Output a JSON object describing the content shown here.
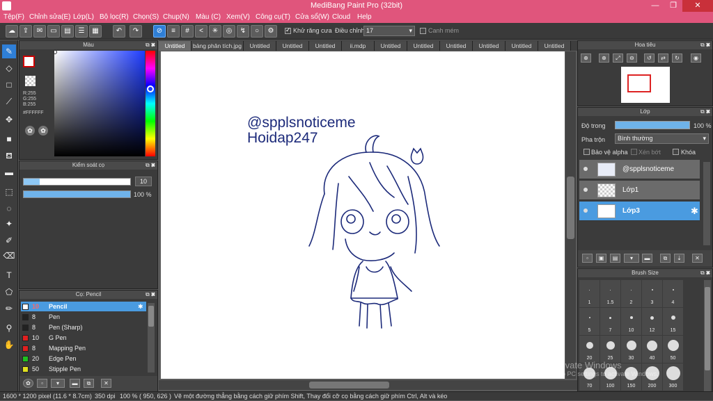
{
  "window": {
    "title": "MediBang Paint Pro (32bit)",
    "minimize": "—",
    "maximize": "❐",
    "close": "✕"
  },
  "menu": [
    "Tệp(F)",
    "Chỉnh sửa(E)",
    "Lớp(L)",
    "Bộ lọc(R)",
    "Chọn(S)",
    "Chup(N)",
    "Màu (C)",
    "Xem(V)",
    "Công cụ(T)",
    "Cửa sổ(W)",
    "Cloud",
    "Help"
  ],
  "toolbar": {
    "antialias_label": "Khử răng cưa",
    "adjust_label": "Điều chỉnh",
    "adjust_value": "17",
    "snap_label": "Canh mém"
  },
  "color_panel": {
    "title": "Màu",
    "r": "R:255",
    "g": "G:255",
    "b": "B:255",
    "hex": "#FFFFFF"
  },
  "brush_control": {
    "title": "Kiểm soát cọ",
    "size": "10",
    "opacity": "100 %",
    "size_fraction": 0.15,
    "opacity_fraction": 1.0
  },
  "brush_panel": {
    "title": "Cọ: Pencil",
    "items": [
      {
        "size": "10",
        "name": "Pencil",
        "color": "#ffffff"
      },
      {
        "size": "8",
        "name": "Pen",
        "color": "#222222"
      },
      {
        "size": "8",
        "name": "Pen (Sharp)",
        "color": "#222222"
      },
      {
        "size": "10",
        "name": "G Pen",
        "color": "#e02020"
      },
      {
        "size": "8",
        "name": "Mapping Pen",
        "color": "#e02020"
      },
      {
        "size": "20",
        "name": "Edge Pen",
        "color": "#20c020"
      },
      {
        "size": "50",
        "name": "Stipple Pen",
        "color": "#e0e020"
      }
    ]
  },
  "tabs": [
    "Untitled",
    "bảng phân tích.jpg",
    "Untitled",
    "Untitled",
    "Untitled",
    "ii.mdp",
    "Untitled",
    "Untitled",
    "Untitled",
    "Untitled",
    "Untitled",
    "Untitled"
  ],
  "canvas": {
    "text_line1": "@spplsnoticeme",
    "text_line2": "Hoidap247",
    "ink_color": "#1c2a7a"
  },
  "navigator": {
    "title": "Hoa tiêu"
  },
  "layer_panel": {
    "title": "Lớp",
    "opacity_label": "Độ trong",
    "opacity_value": "100 %",
    "blend_label": "Pha trộn",
    "blend_value": "Bình thường",
    "protect_alpha": "Bảo vệ alpha",
    "clipping": "Xén bớt",
    "lock": "Khóa",
    "layers": [
      "@spplsnoticeme",
      "Lớp1",
      "Lớp3"
    ]
  },
  "brush_size_panel": {
    "title": "Brush Size",
    "sizes": [
      "1",
      "1.5",
      "2",
      "3",
      "4",
      "5",
      "7",
      "10",
      "12",
      "15",
      "20",
      "25",
      "30",
      "40",
      "50",
      "70",
      "100",
      "150",
      "200",
      "300"
    ]
  },
  "watermark": {
    "line1": "Activate Windows",
    "line2": "Go to PC settings to activate Windows."
  },
  "status": {
    "size": "1600 * 1200 pixel",
    "cm": "(11.6 * 8.7cm)",
    "dpi": "350 dpi",
    "zoom": "100 %",
    "coords": "( 950, 626 )",
    "hint": "Vẽ một đường thẳng bằng cách giữ phím Shift, Thay đổi cỡ cọ bằng cách giữ phím Ctrl, Alt và kéo"
  }
}
